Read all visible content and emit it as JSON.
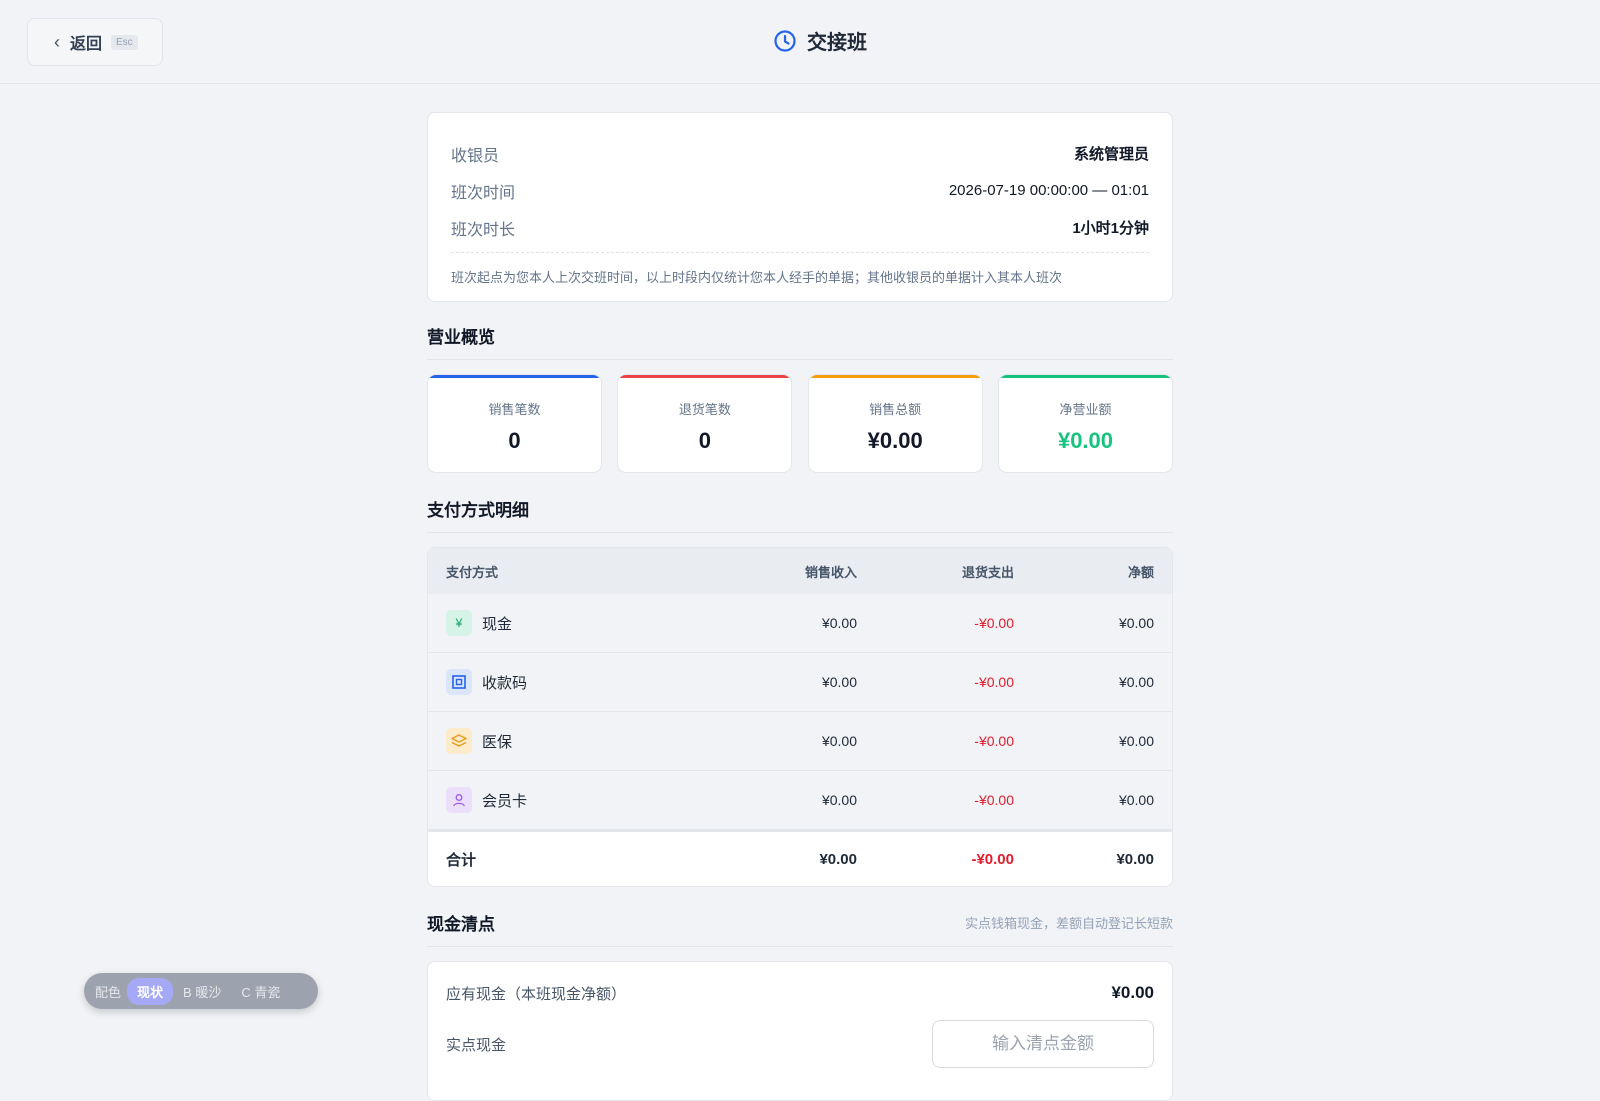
{
  "header": {
    "back_label": "返回",
    "back_key": "Esc",
    "title": "交接班"
  },
  "shift": {
    "rows": [
      {
        "label": "收银员",
        "value": "系统管理员"
      },
      {
        "label": "班次时间",
        "value": "2026-07-19 00:00:00 — 01:01"
      },
      {
        "label": "班次时长",
        "value": "1小时1分钟"
      }
    ],
    "note": "班次起点为您本人上次交班时间，以上时段内仅统计您本人经手的单据；其他收银员的单据计入其本人班次"
  },
  "overview": {
    "title": "营业概览",
    "stats": [
      {
        "label": "销售笔数",
        "value": "0",
        "color": "#2563eb"
      },
      {
        "label": "退货笔数",
        "value": "0",
        "color": "#ef4444"
      },
      {
        "label": "销售总额",
        "value": "¥0.00",
        "color": "#f59e0b"
      },
      {
        "label": "净营业额",
        "value": "¥0.00",
        "color": "#16c47f"
      }
    ]
  },
  "payments": {
    "title": "支付方式明细",
    "columns": [
      "支付方式",
      "销售收入",
      "退货支出",
      "净额"
    ],
    "rows": [
      {
        "method": "现金",
        "icon": "yuan-icon",
        "sales": "¥0.00",
        "refund": "-¥0.00",
        "net": "¥0.00"
      },
      {
        "method": "收款码",
        "icon": "qr-code-icon",
        "sales": "¥0.00",
        "refund": "-¥0.00",
        "net": "¥0.00"
      },
      {
        "method": "医保",
        "icon": "layers-icon",
        "sales": "¥0.00",
        "refund": "-¥0.00",
        "net": "¥0.00"
      },
      {
        "method": "会员卡",
        "icon": "user-icon",
        "sales": "¥0.00",
        "refund": "-¥0.00",
        "net": "¥0.00"
      }
    ],
    "total": {
      "label": "合计",
      "sales": "¥0.00",
      "refund": "-¥0.00",
      "net": "¥0.00"
    }
  },
  "cash": {
    "title": "现金清点",
    "hint": "实点钱箱现金，差额自动登记长短款",
    "expected_label": "应有现金（本班现金净额）",
    "expected_value": "¥0.00",
    "actual_label": "实点现金",
    "actual_placeholder": "输入清点金额"
  },
  "theme": {
    "label": "配色",
    "options": [
      "现状",
      "B 暖沙",
      "C 青瓷"
    ],
    "active": "现状"
  },
  "colors": {
    "accent": "#2563eb",
    "negative": "#e11d2e",
    "positive": "#16c47f"
  }
}
